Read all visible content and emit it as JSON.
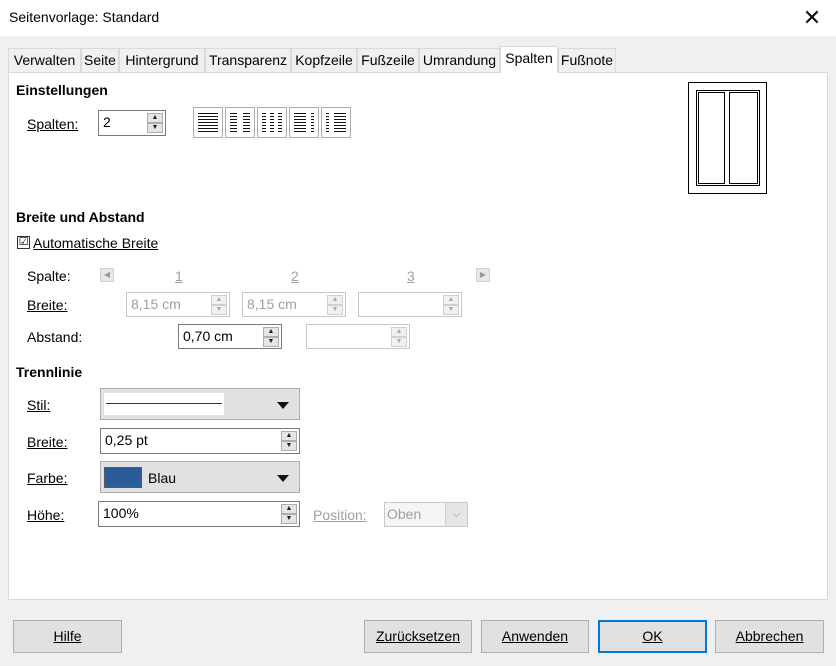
{
  "window": {
    "title": "Seitenvorlage: Standard"
  },
  "tabs": [
    {
      "label": "Verwalten"
    },
    {
      "label": "Seite"
    },
    {
      "label": "Hintergrund"
    },
    {
      "label": "Transparenz"
    },
    {
      "label": "Kopfzeile"
    },
    {
      "label": "Fußzeile"
    },
    {
      "label": "Umrandung"
    },
    {
      "label": "Spalten"
    },
    {
      "label": "Fußnote"
    }
  ],
  "settings": {
    "heading": "Einstellungen",
    "columns_label": "Spalten:",
    "columns_value": "2"
  },
  "width_spacing": {
    "heading": "Breite und Abstand",
    "auto_width_label": "Automatische Breite",
    "auto_width_checked": "☑",
    "column_label": "Spalte:",
    "col_numbers": [
      "1",
      "2",
      "3"
    ],
    "width_label": "Breite:",
    "width_values": [
      "8,15 cm",
      "8,15 cm",
      ""
    ],
    "spacing_label": "Abstand:",
    "spacing_values": [
      "0,70 cm",
      ""
    ]
  },
  "separator": {
    "heading": "Trennlinie",
    "style_label": "Stil:",
    "width_label": "Breite:",
    "width_value": "0,25 pt",
    "color_label": "Farbe:",
    "color_value": "Blau",
    "color_hex": "#2a5c9a",
    "height_label": "Höhe:",
    "height_value": "100%",
    "position_label": "Position:",
    "position_value": "Oben"
  },
  "buttons": {
    "help": "Hilfe",
    "reset": "Zurücksetzen",
    "apply": "Anwenden",
    "ok": "OK",
    "cancel": "Abbrechen"
  }
}
